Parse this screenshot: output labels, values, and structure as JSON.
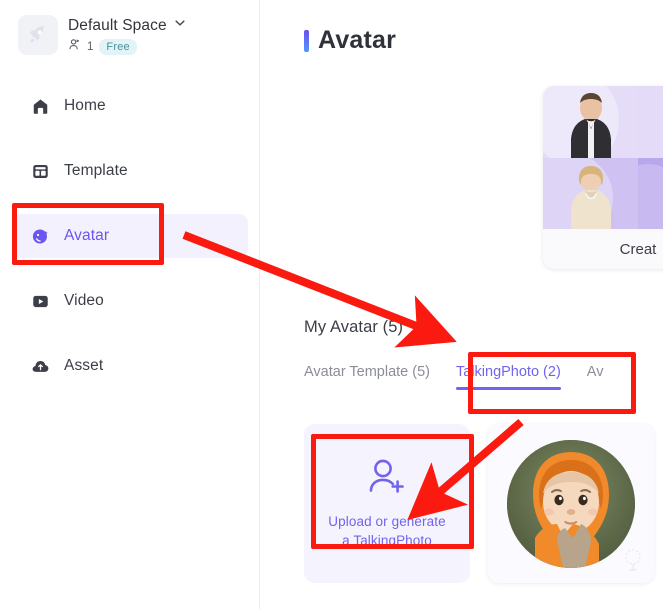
{
  "sidebar": {
    "space": {
      "logo_icon": "rocket-icon",
      "name": "Default Space",
      "dropdown_icon": "chevron-down-icon",
      "member_icon": "member-icon",
      "member_count": "1",
      "plan_badge": "Free"
    },
    "items": [
      {
        "label": "Home",
        "icon": "home-icon",
        "active": false
      },
      {
        "label": "Template",
        "icon": "template-icon",
        "active": false
      },
      {
        "label": "Avatar",
        "icon": "avatar-icon",
        "active": true
      },
      {
        "label": "Video",
        "icon": "video-icon",
        "active": false
      },
      {
        "label": "Asset",
        "icon": "cloud-upload-icon",
        "active": false
      }
    ]
  },
  "main": {
    "page_title": "Avatar",
    "create_card": {
      "footer_label": "Creat"
    },
    "my_avatar_heading": "My Avatar (5)",
    "tabs": [
      {
        "label": "Avatar Template (5)",
        "active": false
      },
      {
        "label": "TalkingPhoto (2)",
        "active": true
      },
      {
        "label": "Av",
        "active": false
      }
    ],
    "upload_card": {
      "icon": "user-plus-icon",
      "line1": "Upload or generate",
      "line2": "a TalkingPhoto"
    },
    "photo_card": {
      "alt": "baby-in-orange-hood-photo"
    }
  },
  "annotations": {
    "accent_color": "#fb1a10",
    "boxes": [
      "sidebar-avatar-item",
      "talkingphoto-tab",
      "upload-talkingphoto-card"
    ],
    "arrows": [
      "avatar-item-to-my-avatar",
      "talkingphoto-tab-to-upload-card"
    ]
  },
  "colors": {
    "brand_purple": "#7163ee",
    "active_nav_bg": "#f3f1fd",
    "free_badge_bg": "#e2f4f7",
    "annotation_red": "#fb1a10"
  }
}
